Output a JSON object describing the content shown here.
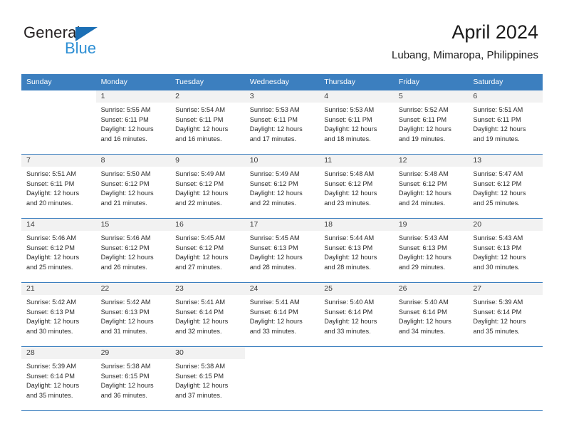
{
  "brand": {
    "line1": "General",
    "line2": "Blue",
    "accent_color": "#2e8fd4",
    "triangle_color": "#1b6fb5"
  },
  "header": {
    "title": "April 2024",
    "subtitle": "Lubang, Mimaropa, Philippines"
  },
  "theme": {
    "header_bg": "#3c7fbf",
    "header_text": "#ffffff",
    "daynum_bg": "#f2f2f2",
    "body_text": "#2b2b2b"
  },
  "weekdays": [
    "Sunday",
    "Monday",
    "Tuesday",
    "Wednesday",
    "Thursday",
    "Friday",
    "Saturday"
  ],
  "weeks": [
    [
      {
        "day": ""
      },
      {
        "day": "1",
        "sunrise": "Sunrise: 5:55 AM",
        "sunset": "Sunset: 6:11 PM",
        "daylight1": "Daylight: 12 hours",
        "daylight2": "and 16 minutes."
      },
      {
        "day": "2",
        "sunrise": "Sunrise: 5:54 AM",
        "sunset": "Sunset: 6:11 PM",
        "daylight1": "Daylight: 12 hours",
        "daylight2": "and 16 minutes."
      },
      {
        "day": "3",
        "sunrise": "Sunrise: 5:53 AM",
        "sunset": "Sunset: 6:11 PM",
        "daylight1": "Daylight: 12 hours",
        "daylight2": "and 17 minutes."
      },
      {
        "day": "4",
        "sunrise": "Sunrise: 5:53 AM",
        "sunset": "Sunset: 6:11 PM",
        "daylight1": "Daylight: 12 hours",
        "daylight2": "and 18 minutes."
      },
      {
        "day": "5",
        "sunrise": "Sunrise: 5:52 AM",
        "sunset": "Sunset: 6:11 PM",
        "daylight1": "Daylight: 12 hours",
        "daylight2": "and 19 minutes."
      },
      {
        "day": "6",
        "sunrise": "Sunrise: 5:51 AM",
        "sunset": "Sunset: 6:11 PM",
        "daylight1": "Daylight: 12 hours",
        "daylight2": "and 19 minutes."
      }
    ],
    [
      {
        "day": "7",
        "sunrise": "Sunrise: 5:51 AM",
        "sunset": "Sunset: 6:11 PM",
        "daylight1": "Daylight: 12 hours",
        "daylight2": "and 20 minutes."
      },
      {
        "day": "8",
        "sunrise": "Sunrise: 5:50 AM",
        "sunset": "Sunset: 6:12 PM",
        "daylight1": "Daylight: 12 hours",
        "daylight2": "and 21 minutes."
      },
      {
        "day": "9",
        "sunrise": "Sunrise: 5:49 AM",
        "sunset": "Sunset: 6:12 PM",
        "daylight1": "Daylight: 12 hours",
        "daylight2": "and 22 minutes."
      },
      {
        "day": "10",
        "sunrise": "Sunrise: 5:49 AM",
        "sunset": "Sunset: 6:12 PM",
        "daylight1": "Daylight: 12 hours",
        "daylight2": "and 22 minutes."
      },
      {
        "day": "11",
        "sunrise": "Sunrise: 5:48 AM",
        "sunset": "Sunset: 6:12 PM",
        "daylight1": "Daylight: 12 hours",
        "daylight2": "and 23 minutes."
      },
      {
        "day": "12",
        "sunrise": "Sunrise: 5:48 AM",
        "sunset": "Sunset: 6:12 PM",
        "daylight1": "Daylight: 12 hours",
        "daylight2": "and 24 minutes."
      },
      {
        "day": "13",
        "sunrise": "Sunrise: 5:47 AM",
        "sunset": "Sunset: 6:12 PM",
        "daylight1": "Daylight: 12 hours",
        "daylight2": "and 25 minutes."
      }
    ],
    [
      {
        "day": "14",
        "sunrise": "Sunrise: 5:46 AM",
        "sunset": "Sunset: 6:12 PM",
        "daylight1": "Daylight: 12 hours",
        "daylight2": "and 25 minutes."
      },
      {
        "day": "15",
        "sunrise": "Sunrise: 5:46 AM",
        "sunset": "Sunset: 6:12 PM",
        "daylight1": "Daylight: 12 hours",
        "daylight2": "and 26 minutes."
      },
      {
        "day": "16",
        "sunrise": "Sunrise: 5:45 AM",
        "sunset": "Sunset: 6:12 PM",
        "daylight1": "Daylight: 12 hours",
        "daylight2": "and 27 minutes."
      },
      {
        "day": "17",
        "sunrise": "Sunrise: 5:45 AM",
        "sunset": "Sunset: 6:13 PM",
        "daylight1": "Daylight: 12 hours",
        "daylight2": "and 28 minutes."
      },
      {
        "day": "18",
        "sunrise": "Sunrise: 5:44 AM",
        "sunset": "Sunset: 6:13 PM",
        "daylight1": "Daylight: 12 hours",
        "daylight2": "and 28 minutes."
      },
      {
        "day": "19",
        "sunrise": "Sunrise: 5:43 AM",
        "sunset": "Sunset: 6:13 PM",
        "daylight1": "Daylight: 12 hours",
        "daylight2": "and 29 minutes."
      },
      {
        "day": "20",
        "sunrise": "Sunrise: 5:43 AM",
        "sunset": "Sunset: 6:13 PM",
        "daylight1": "Daylight: 12 hours",
        "daylight2": "and 30 minutes."
      }
    ],
    [
      {
        "day": "21",
        "sunrise": "Sunrise: 5:42 AM",
        "sunset": "Sunset: 6:13 PM",
        "daylight1": "Daylight: 12 hours",
        "daylight2": "and 30 minutes."
      },
      {
        "day": "22",
        "sunrise": "Sunrise: 5:42 AM",
        "sunset": "Sunset: 6:13 PM",
        "daylight1": "Daylight: 12 hours",
        "daylight2": "and 31 minutes."
      },
      {
        "day": "23",
        "sunrise": "Sunrise: 5:41 AM",
        "sunset": "Sunset: 6:14 PM",
        "daylight1": "Daylight: 12 hours",
        "daylight2": "and 32 minutes."
      },
      {
        "day": "24",
        "sunrise": "Sunrise: 5:41 AM",
        "sunset": "Sunset: 6:14 PM",
        "daylight1": "Daylight: 12 hours",
        "daylight2": "and 33 minutes."
      },
      {
        "day": "25",
        "sunrise": "Sunrise: 5:40 AM",
        "sunset": "Sunset: 6:14 PM",
        "daylight1": "Daylight: 12 hours",
        "daylight2": "and 33 minutes."
      },
      {
        "day": "26",
        "sunrise": "Sunrise: 5:40 AM",
        "sunset": "Sunset: 6:14 PM",
        "daylight1": "Daylight: 12 hours",
        "daylight2": "and 34 minutes."
      },
      {
        "day": "27",
        "sunrise": "Sunrise: 5:39 AM",
        "sunset": "Sunset: 6:14 PM",
        "daylight1": "Daylight: 12 hours",
        "daylight2": "and 35 minutes."
      }
    ],
    [
      {
        "day": "28",
        "sunrise": "Sunrise: 5:39 AM",
        "sunset": "Sunset: 6:14 PM",
        "daylight1": "Daylight: 12 hours",
        "daylight2": "and 35 minutes."
      },
      {
        "day": "29",
        "sunrise": "Sunrise: 5:38 AM",
        "sunset": "Sunset: 6:15 PM",
        "daylight1": "Daylight: 12 hours",
        "daylight2": "and 36 minutes."
      },
      {
        "day": "30",
        "sunrise": "Sunrise: 5:38 AM",
        "sunset": "Sunset: 6:15 PM",
        "daylight1": "Daylight: 12 hours",
        "daylight2": "and 37 minutes."
      },
      {
        "day": ""
      },
      {
        "day": ""
      },
      {
        "day": ""
      },
      {
        "day": ""
      }
    ]
  ]
}
